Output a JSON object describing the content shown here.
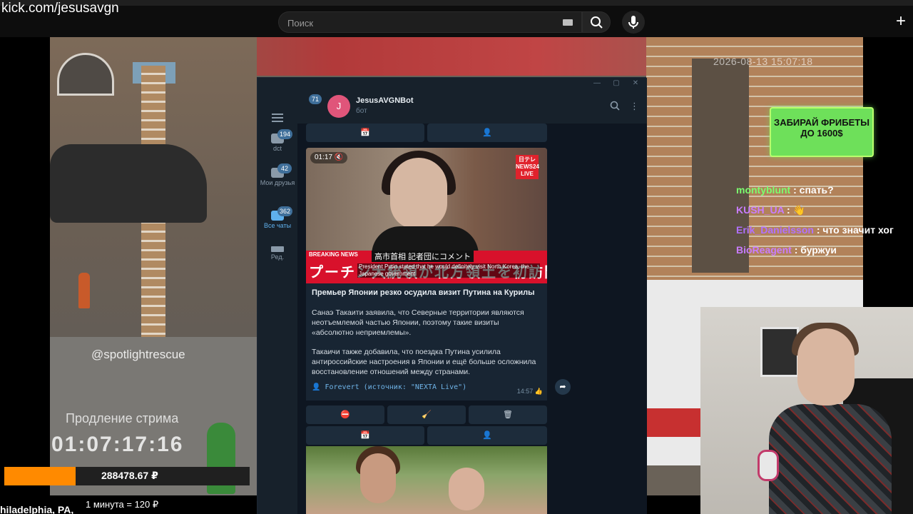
{
  "browser": {
    "url": "kick.com/jesusavgn",
    "search_placeholder": "Поиск"
  },
  "scene": {
    "timestamp": "2026-08-13 15:07:18",
    "watermark": "@spotlightrescue"
  },
  "promo": {
    "text": "ЗАБИРАЙ ФРИБЕТЫ ДО 1600$"
  },
  "chat": [
    {
      "user": "montyblunt",
      "color": "#7bff6f",
      "message": ": спать?"
    },
    {
      "user": "KUSH_UA",
      "color": "#c87cff",
      "message": ": 👋"
    },
    {
      "user": "Erik_Danielsson",
      "color": "#b070ff",
      "message": ": что значит хог"
    },
    {
      "user": "BioReagent",
      "color": "#c87cff",
      "message": ": буржуи"
    }
  ],
  "stream": {
    "prolong_label": "Продление стрима",
    "timer": "01:07:17:16",
    "donate_amount": "288478.67 ₽",
    "donate_progress": 0.29,
    "rate": "1 минута = 120 ₽",
    "location": "hiladelphia, PA,"
  },
  "telegram": {
    "sidebar": [
      {
        "label": "dct",
        "badge": "194"
      },
      {
        "label": "Мои друзья",
        "badge": "42"
      },
      {
        "label": "Все чаты",
        "badge": "362",
        "active": true
      },
      {
        "label": "Ред.",
        "badge": ""
      }
    ],
    "header": {
      "back_badge": "71",
      "avatar_letter": "J",
      "name": "JesusAVGNBot",
      "subtitle": "бот"
    },
    "media": {
      "duration": "01:17",
      "channel_logo": "日テレ NEWS24 LIVE",
      "breaking": "BREAKING NEWS",
      "jp_line1": "高市首相 記者団にコメント",
      "jp_line2": "プーチン大統領が北方領土を初訪問",
      "en_caption": "President Putin stated that he would definitely visit North Korea, the Japanese government"
    },
    "message": {
      "title": "Премьер Японии резко осудила визит Путина на Курилы",
      "p1": "Санаэ Такаити заявила, что Северные территории являются неотъемлемой частью Японии, поэтому такие визиты «абсолютно неприемлемы».",
      "p2": "Такаичи также добавила, что поездка Путина усилила антироссийские настроения в Японии и ещё больше осложнила восстановление отношений между странами.",
      "source": "👤 Forevert (источник: \"NEXTA Live\")",
      "time": "14:57 👍"
    },
    "keyboard_icons": {
      "calendar": "📅",
      "person": "👤",
      "block": "⛔",
      "broom": "🧹",
      "trash": "🗑"
    }
  }
}
